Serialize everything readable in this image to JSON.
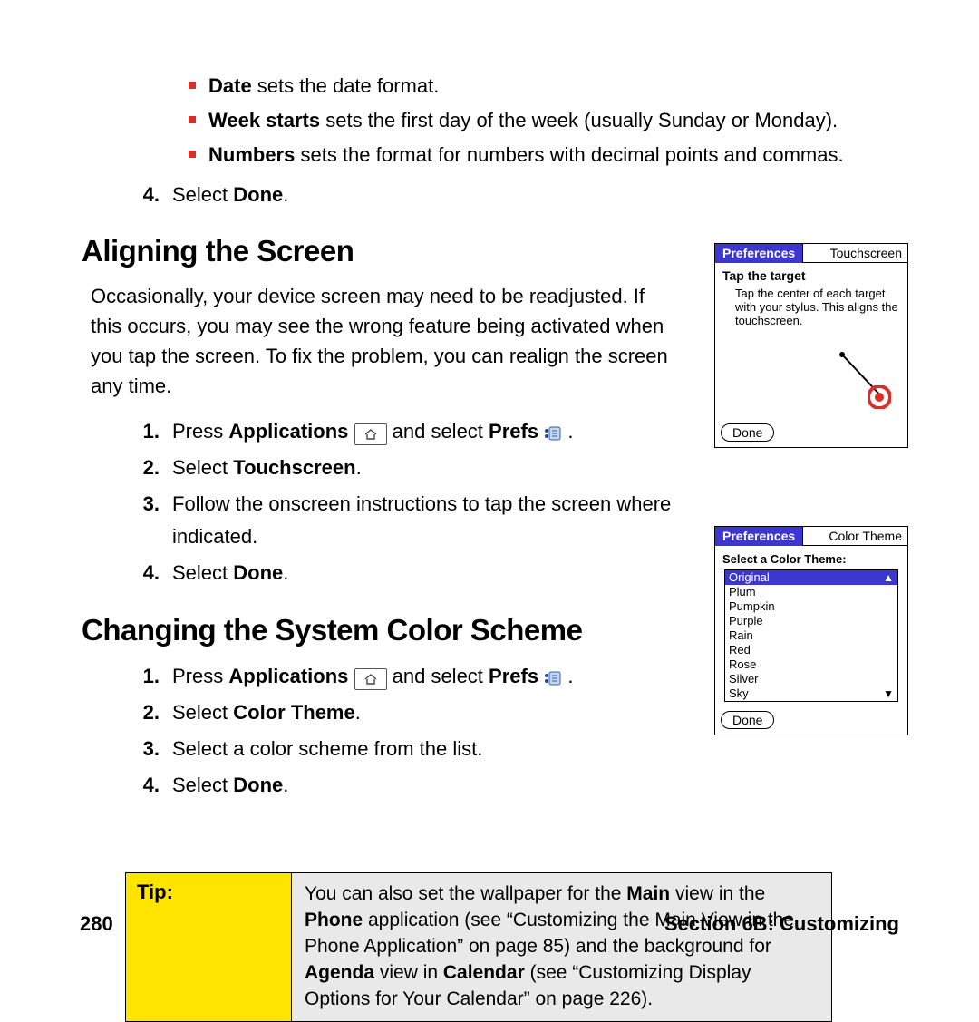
{
  "bullets": {
    "date": {
      "label": "Date",
      "text": " sets the date format."
    },
    "weekstarts": {
      "label": "Week starts",
      "text": " sets the first day of the week (usually Sunday or Monday)."
    },
    "numbers": {
      "label": "Numbers",
      "text": " sets the format for numbers with decimal points and commas."
    }
  },
  "step4": {
    "num": "4.",
    "text": "Select ",
    "bold": "Done",
    "suffix": "."
  },
  "sec_align": {
    "title": "Aligning the Screen",
    "para": "Occasionally, your device screen may need to be readjusted. If this occurs, you may see the wrong feature being activated when you tap the screen. To fix the problem, you can realign the screen any time.",
    "s1": {
      "num": "1.",
      "a": "Press ",
      "b": "Applications",
      "c": " and select ",
      "d": "Prefs",
      "e": " ."
    },
    "s2": {
      "num": "2.",
      "a": "Select ",
      "b": "Touchscreen",
      "c": "."
    },
    "s3": {
      "num": "3.",
      "a": "Follow the onscreen instructions to tap the screen where indicated."
    },
    "s4": {
      "num": "4.",
      "a": "Select ",
      "b": "Done",
      "c": "."
    }
  },
  "sec_color": {
    "title": "Changing the System Color Scheme",
    "s1": {
      "num": "1.",
      "a": "Press ",
      "b": "Applications",
      "c": " and select ",
      "d": "Prefs",
      "e": " ."
    },
    "s2": {
      "num": "2.",
      "a": "Select ",
      "b": "Color Theme",
      "c": "."
    },
    "s3": {
      "num": "3.",
      "a": "Select a color scheme from the list."
    },
    "s4": {
      "num": "4.",
      "a": "Select ",
      "b": "Done",
      "c": "."
    }
  },
  "shot_touch": {
    "prefs": "Preferences",
    "right": "Touchscreen",
    "heading": "Tap the target",
    "instr": "Tap the center of each target with your stylus.  This aligns the touchscreen.",
    "done": "Done"
  },
  "shot_color": {
    "prefs": "Preferences",
    "right": "Color Theme",
    "heading": "Select a Color Theme:",
    "items": {
      "i0": "Original",
      "i1": "Plum",
      "i2": "Pumpkin",
      "i3": "Purple",
      "i4": "Rain",
      "i5": "Red",
      "i6": "Rose",
      "i7": "Silver",
      "i8": "Sky"
    },
    "done": "Done"
  },
  "tip": {
    "label": "Tip:",
    "t1": "You can also set the wallpaper for the ",
    "b1": "Main",
    "t2": " view in the ",
    "b2": "Phone",
    "t3": " application (see “Customizing the Main View in the Phone Application” on page 85) and the background for ",
    "b3": "Agenda",
    "t4": " view in ",
    "b4": "Calendar",
    "t5": " (see “Customizing Display Options for Your Calendar” on page 226)."
  },
  "footer": {
    "page": "280",
    "section": "Section 6B: Customizing"
  }
}
